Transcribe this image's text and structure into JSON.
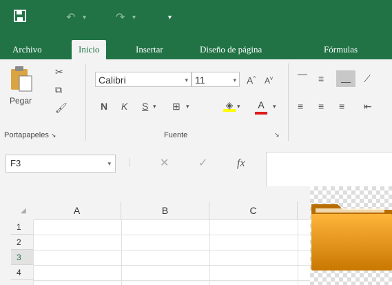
{
  "qat": {
    "save_icon": "save-icon",
    "undo_icon": "undo-icon",
    "redo_icon": "redo-icon",
    "customize_icon": "customize-icon"
  },
  "tabs": [
    {
      "label": "Archivo"
    },
    {
      "label": "Inicio",
      "active": true
    },
    {
      "label": "Insertar"
    },
    {
      "label": "Diseño de página"
    },
    {
      "label": "Fórmulas"
    }
  ],
  "ribbon": {
    "paste_label": "Pegar",
    "clipboard_group": "Portapapeles",
    "font_name": "Calibri",
    "font_size": "11",
    "bold": "N",
    "italic": "K",
    "underline": "S",
    "grow_font": "A",
    "shrink_font": "A",
    "font_color_letter": "A",
    "font_group": "Fuente"
  },
  "formula_bar": {
    "name_box": "F3",
    "cancel": "✕",
    "enter": "✓",
    "fx": "fx",
    "value": ""
  },
  "grid": {
    "columns": [
      "A",
      "B",
      "C"
    ],
    "rows": [
      "1",
      "2",
      "3",
      "4"
    ],
    "selected_row": "3"
  },
  "colors": {
    "brand": "#217346",
    "folder": "#e8a317"
  },
  "overlay": {
    "icon": "folder-icon"
  }
}
